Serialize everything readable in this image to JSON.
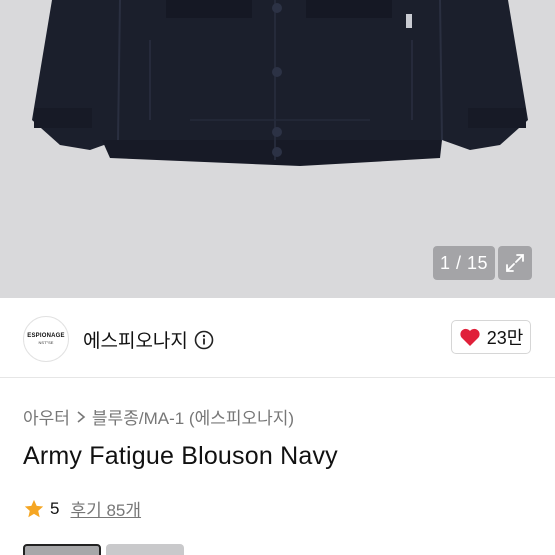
{
  "gallery": {
    "counter": "1 / 15",
    "expand_icon": "expand-icon"
  },
  "brand": {
    "logo_text": "ESPIONAGE",
    "logo_subtext": "NST°SE",
    "name": "에스피오나지",
    "info_icon": "info-icon"
  },
  "like": {
    "icon": "heart-icon",
    "count": "23만",
    "color": "#e0203a"
  },
  "breadcrumb": {
    "category": "아우터",
    "subcategory": "블루종/MA-1 (에스피오나지)"
  },
  "product": {
    "title": "Army Fatigue Blouson Navy"
  },
  "rating": {
    "icon": "star-icon",
    "star_color": "#f5a623",
    "score": "5",
    "reviews": "후기 85개"
  },
  "colors": {
    "jacket": "#1b1f2c",
    "background": "#d9d9db"
  }
}
